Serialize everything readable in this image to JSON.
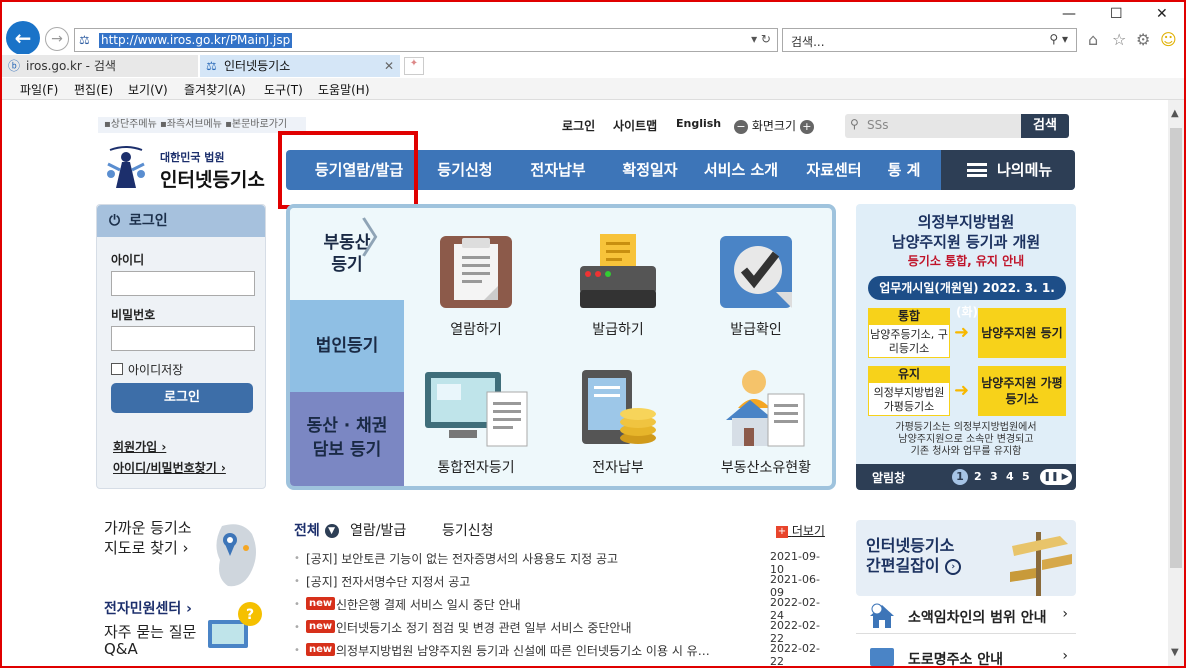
{
  "browser": {
    "url": "http://www.iros.go.kr/PMainJ.jsp",
    "search_placeholder": "검색...",
    "tabs": [
      {
        "label": "iros.go.kr - 검색"
      },
      {
        "label": "인터넷등기소"
      }
    ],
    "menu": [
      "파일(F)",
      "편집(E)",
      "보기(V)",
      "즐겨찾기(A)",
      "도구(T)",
      "도움말(H)"
    ],
    "window_controls": [
      "—",
      "☐",
      "✕"
    ]
  },
  "header": {
    "skip_links": "▪상단주메뉴 ▪좌측서브메뉴 ▪본문바로가기",
    "login": "로그인",
    "sitemap": "사이트맵",
    "english": "English",
    "zoom_label": "화면크기",
    "search_placeholder": "SSs",
    "search_button": "검색",
    "logo_small": "대한민국 법원",
    "logo_big": "인터넷등기소"
  },
  "gnb": {
    "items": [
      "등기열람/발급",
      "등기신청",
      "전자납부",
      "확정일자",
      "서비스 소개",
      "자료센터",
      "통 계"
    ],
    "my_menu": "나의메뉴"
  },
  "login": {
    "title": "로그인",
    "id_label": "아이디",
    "pw_label": "비밀번호",
    "save_id": "아이디저장",
    "button": "로그인",
    "join": "회원가입 ›",
    "find": "아이디/비밀번호찾기 ›"
  },
  "services": {
    "tabs": [
      "부동산\n등기",
      "법인등기",
      "동산 · 채권\n담보 등기"
    ],
    "tab1_line1": "부동산",
    "tab1_line2": "등기",
    "tab2": "법인등기",
    "tab3_line1": "동산 · 채권",
    "tab3_line2": "담보 등기",
    "tiles": [
      "열람하기",
      "발급하기",
      "발급확인",
      "통합전자등기",
      "전자납부",
      "부동산소유현황"
    ]
  },
  "banner": {
    "title_line1": "의정부지방법원",
    "title_line2": "남양주지원 등기과 개원",
    "subtitle": "등기소 통합, 유지 안내",
    "date_pill": "업무개시일(개원일) 2022. 3. 1. (화)",
    "merge_label": "통합",
    "merge_from": "남양주등기소, 구리등기소",
    "merge_to": "남양주지원 등기과",
    "keep_label": "유지",
    "keep_from": "의정부지방법원 가평등기소",
    "keep_to": "남양주지원 가평등기소",
    "note_line1": "가평등기소는 의정부지방법원에서",
    "note_line2": "남양주지원으로 소속만 변경되고",
    "note_line3": "기존 청사와 업무를 유지함",
    "bar_label": "알림창",
    "pages": [
      "1",
      "2",
      "3",
      "4",
      "5"
    ],
    "current_page": 1
  },
  "quick": {
    "near_line1": "가까운 등기소",
    "near_line2": "지도로 찾기 ›",
    "minwon": "전자민원센터 ›",
    "faq_line1": "자주 묻는 질문",
    "faq_line2": "Q&A"
  },
  "notices": {
    "tabs": [
      "전체",
      "열람/발급",
      "등기신청"
    ],
    "more": "더보기",
    "rows": [
      {
        "new": false,
        "title": "[공지] 보안토큰 기능이 없는 전자증명서의 사용용도 지정 공고",
        "date": "2021-09-10"
      },
      {
        "new": false,
        "title": "[공지] 전자서명수단 지정서 공고",
        "date": "2021-06-09"
      },
      {
        "new": true,
        "title": "신한은행 결제 서비스 일시 중단 안내",
        "date": "2022-02-24"
      },
      {
        "new": true,
        "title": "인터넷등기소 정기 점검 및 변경 관련 일부 서비스 중단안내",
        "date": "2022-02-22"
      },
      {
        "new": true,
        "title": "의정부지방법원 남양주지원 등기과 신설에 따른 인터넷등기소 이용 시 유…",
        "date": "2022-02-22"
      }
    ],
    "new_badge": "new"
  },
  "right": {
    "guide_line1": "인터넷등기소",
    "guide_line2": "간편길잡이",
    "links": [
      "소액임차인의 범위 안내",
      "도로명주소 안내"
    ]
  },
  "colors": {
    "gnb": "#3d75b8",
    "dark": "#2d3e55",
    "highlight": "#e00000"
  }
}
